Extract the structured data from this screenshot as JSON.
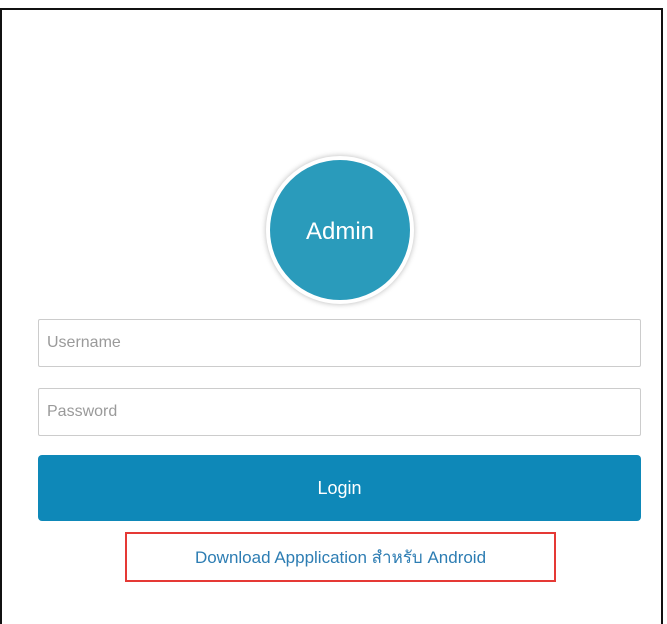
{
  "login_panel": {
    "avatar_label": "Admin",
    "username_placeholder": "Username",
    "password_placeholder": "Password",
    "login_label": "Login",
    "download_link_label": "Download Appplication สำหรับ Android"
  },
  "colors": {
    "avatar_background": "#2a9bbb",
    "button_background": "#0e88b8",
    "link_text": "#2d7db3",
    "highlight_border": "#e53935"
  }
}
